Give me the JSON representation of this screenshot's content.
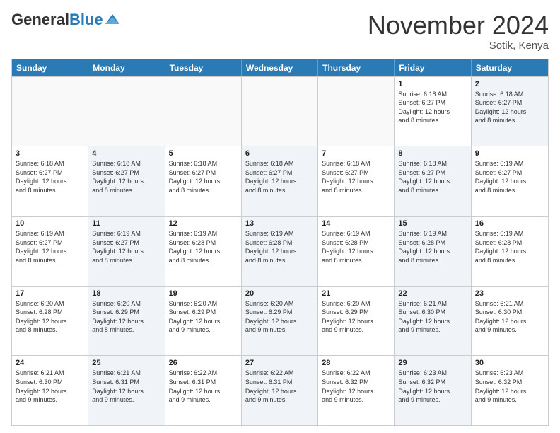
{
  "logo": {
    "general": "General",
    "blue": "Blue"
  },
  "header": {
    "month": "November 2024",
    "location": "Sotik, Kenya"
  },
  "weekdays": [
    "Sunday",
    "Monday",
    "Tuesday",
    "Wednesday",
    "Thursday",
    "Friday",
    "Saturday"
  ],
  "rows": [
    [
      {
        "day": "",
        "info": "",
        "empty": true
      },
      {
        "day": "",
        "info": "",
        "empty": true
      },
      {
        "day": "",
        "info": "",
        "empty": true
      },
      {
        "day": "",
        "info": "",
        "empty": true
      },
      {
        "day": "",
        "info": "",
        "empty": true
      },
      {
        "day": "1",
        "info": "Sunrise: 6:18 AM\nSunset: 6:27 PM\nDaylight: 12 hours\nand 8 minutes.",
        "empty": false
      },
      {
        "day": "2",
        "info": "Sunrise: 6:18 AM\nSunset: 6:27 PM\nDaylight: 12 hours\nand 8 minutes.",
        "empty": false,
        "alt": true
      }
    ],
    [
      {
        "day": "3",
        "info": "Sunrise: 6:18 AM\nSunset: 6:27 PM\nDaylight: 12 hours\nand 8 minutes.",
        "empty": false
      },
      {
        "day": "4",
        "info": "Sunrise: 6:18 AM\nSunset: 6:27 PM\nDaylight: 12 hours\nand 8 minutes.",
        "empty": false,
        "alt": true
      },
      {
        "day": "5",
        "info": "Sunrise: 6:18 AM\nSunset: 6:27 PM\nDaylight: 12 hours\nand 8 minutes.",
        "empty": false
      },
      {
        "day": "6",
        "info": "Sunrise: 6:18 AM\nSunset: 6:27 PM\nDaylight: 12 hours\nand 8 minutes.",
        "empty": false,
        "alt": true
      },
      {
        "day": "7",
        "info": "Sunrise: 6:18 AM\nSunset: 6:27 PM\nDaylight: 12 hours\nand 8 minutes.",
        "empty": false
      },
      {
        "day": "8",
        "info": "Sunrise: 6:18 AM\nSunset: 6:27 PM\nDaylight: 12 hours\nand 8 minutes.",
        "empty": false,
        "alt": true
      },
      {
        "day": "9",
        "info": "Sunrise: 6:19 AM\nSunset: 6:27 PM\nDaylight: 12 hours\nand 8 minutes.",
        "empty": false
      }
    ],
    [
      {
        "day": "10",
        "info": "Sunrise: 6:19 AM\nSunset: 6:27 PM\nDaylight: 12 hours\nand 8 minutes.",
        "empty": false
      },
      {
        "day": "11",
        "info": "Sunrise: 6:19 AM\nSunset: 6:27 PM\nDaylight: 12 hours\nand 8 minutes.",
        "empty": false,
        "alt": true
      },
      {
        "day": "12",
        "info": "Sunrise: 6:19 AM\nSunset: 6:28 PM\nDaylight: 12 hours\nand 8 minutes.",
        "empty": false
      },
      {
        "day": "13",
        "info": "Sunrise: 6:19 AM\nSunset: 6:28 PM\nDaylight: 12 hours\nand 8 minutes.",
        "empty": false,
        "alt": true
      },
      {
        "day": "14",
        "info": "Sunrise: 6:19 AM\nSunset: 6:28 PM\nDaylight: 12 hours\nand 8 minutes.",
        "empty": false
      },
      {
        "day": "15",
        "info": "Sunrise: 6:19 AM\nSunset: 6:28 PM\nDaylight: 12 hours\nand 8 minutes.",
        "empty": false,
        "alt": true
      },
      {
        "day": "16",
        "info": "Sunrise: 6:19 AM\nSunset: 6:28 PM\nDaylight: 12 hours\nand 8 minutes.",
        "empty": false
      }
    ],
    [
      {
        "day": "17",
        "info": "Sunrise: 6:20 AM\nSunset: 6:28 PM\nDaylight: 12 hours\nand 8 minutes.",
        "empty": false
      },
      {
        "day": "18",
        "info": "Sunrise: 6:20 AM\nSunset: 6:29 PM\nDaylight: 12 hours\nand 8 minutes.",
        "empty": false,
        "alt": true
      },
      {
        "day": "19",
        "info": "Sunrise: 6:20 AM\nSunset: 6:29 PM\nDaylight: 12 hours\nand 9 minutes.",
        "empty": false
      },
      {
        "day": "20",
        "info": "Sunrise: 6:20 AM\nSunset: 6:29 PM\nDaylight: 12 hours\nand 9 minutes.",
        "empty": false,
        "alt": true
      },
      {
        "day": "21",
        "info": "Sunrise: 6:20 AM\nSunset: 6:29 PM\nDaylight: 12 hours\nand 9 minutes.",
        "empty": false
      },
      {
        "day": "22",
        "info": "Sunrise: 6:21 AM\nSunset: 6:30 PM\nDaylight: 12 hours\nand 9 minutes.",
        "empty": false,
        "alt": true
      },
      {
        "day": "23",
        "info": "Sunrise: 6:21 AM\nSunset: 6:30 PM\nDaylight: 12 hours\nand 9 minutes.",
        "empty": false
      }
    ],
    [
      {
        "day": "24",
        "info": "Sunrise: 6:21 AM\nSunset: 6:30 PM\nDaylight: 12 hours\nand 9 minutes.",
        "empty": false
      },
      {
        "day": "25",
        "info": "Sunrise: 6:21 AM\nSunset: 6:31 PM\nDaylight: 12 hours\nand 9 minutes.",
        "empty": false,
        "alt": true
      },
      {
        "day": "26",
        "info": "Sunrise: 6:22 AM\nSunset: 6:31 PM\nDaylight: 12 hours\nand 9 minutes.",
        "empty": false
      },
      {
        "day": "27",
        "info": "Sunrise: 6:22 AM\nSunset: 6:31 PM\nDaylight: 12 hours\nand 9 minutes.",
        "empty": false,
        "alt": true
      },
      {
        "day": "28",
        "info": "Sunrise: 6:22 AM\nSunset: 6:32 PM\nDaylight: 12 hours\nand 9 minutes.",
        "empty": false
      },
      {
        "day": "29",
        "info": "Sunrise: 6:23 AM\nSunset: 6:32 PM\nDaylight: 12 hours\nand 9 minutes.",
        "empty": false,
        "alt": true
      },
      {
        "day": "30",
        "info": "Sunrise: 6:23 AM\nSunset: 6:32 PM\nDaylight: 12 hours\nand 9 minutes.",
        "empty": false
      }
    ]
  ]
}
